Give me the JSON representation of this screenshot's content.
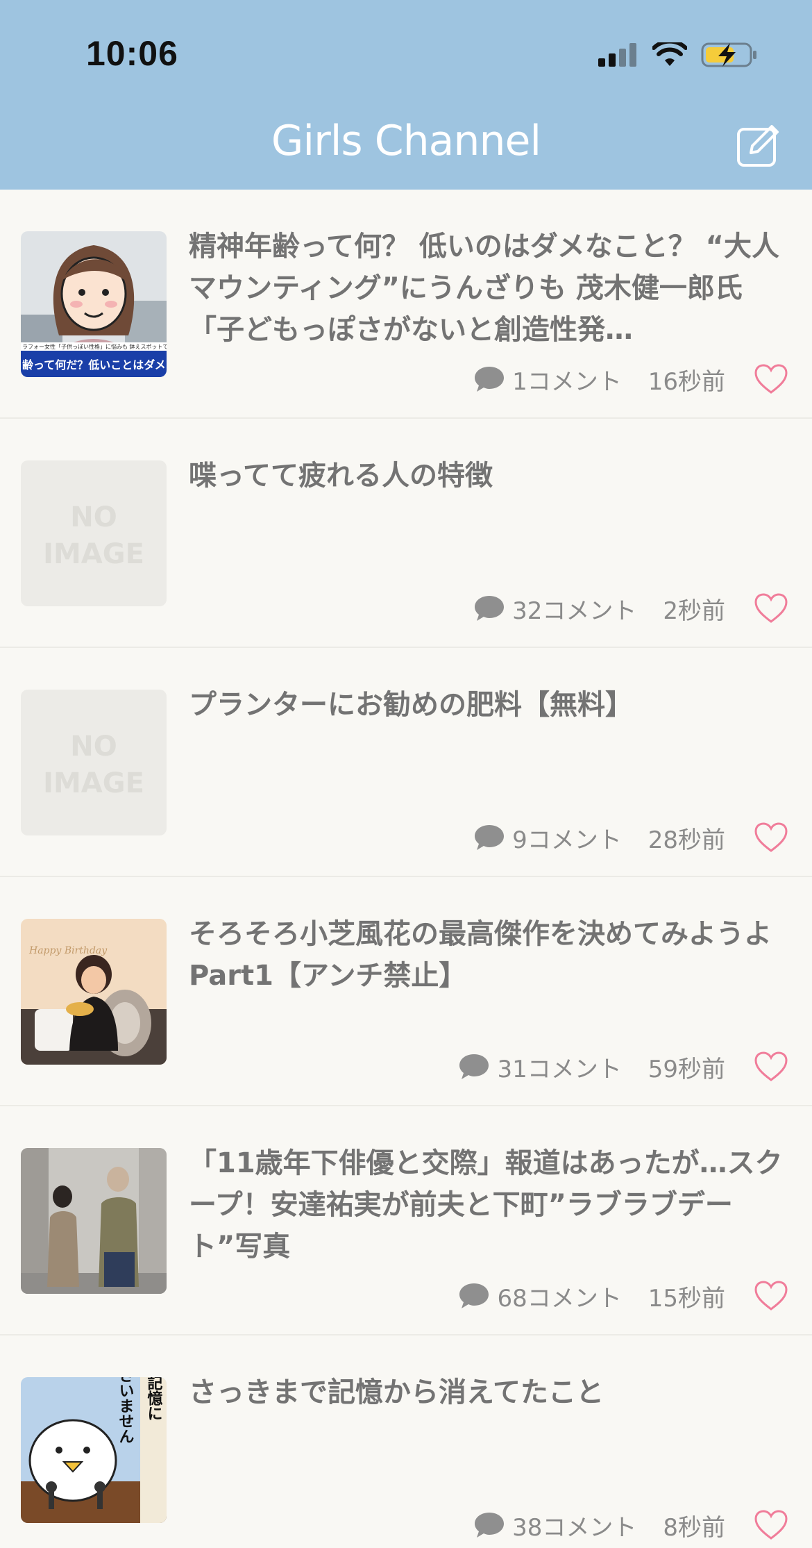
{
  "status_bar": {
    "time": "10:06",
    "icons": [
      "signal-icon",
      "wifi-icon",
      "battery-charging-icon"
    ]
  },
  "header": {
    "title": "Girls Channel",
    "compose_icon": "compose-icon",
    "background_color": "#9ec4e0"
  },
  "topics": [
    {
      "title": "精神年齢って何？ 低いのはダメなこと？ “大人マウンティング”にうんざりも 茂木健一郎氏「子どもっぽさがないと創造性発…",
      "thumbnail": "illustration",
      "thumbnail_caption_top": "ラフォー女性「子供っぽい性格」に悩みも 鉢えスポットではし",
      "thumbnail_caption_bottom": "齢って何だ？低いことはダメなこ",
      "comments": "1コメント",
      "time": "16秒前"
    },
    {
      "title": "喋ってて疲れる人の特徴",
      "thumbnail": "no-image",
      "no_image_text": [
        "NO",
        "IMAGE"
      ],
      "comments": "32コメント",
      "time": "2秒前"
    },
    {
      "title": "プランターにお勧めの肥料【無料】",
      "thumbnail": "no-image",
      "no_image_text": [
        "NO",
        "IMAGE"
      ],
      "comments": "9コメント",
      "time": "28秒前"
    },
    {
      "title": "そろそろ小芝風花の最高傑作を決めてみようよPart1【アンチ禁止】",
      "thumbnail": "photo-birthday",
      "thumbnail_text": "Happy Birthday",
      "comments": "31コメント",
      "time": "59秒前"
    },
    {
      "title": "「11歳年下俳優と交際」報道はあったが…スクープ！安達祐実が前夫と下町”ラブラブデート”写真",
      "thumbnail": "photo-street",
      "comments": "68コメント",
      "time": "15秒前"
    },
    {
      "title": "さっきまで記憶から消えてたこと",
      "thumbnail": "illustration-bird",
      "thumbnail_text": [
        "記憶に",
        "ございません"
      ],
      "comments": "38コメント",
      "time": "8秒前"
    }
  ],
  "colors": {
    "like_heart": "#f07d9a",
    "comment_icon": "#8f8f8f",
    "title_text": "#737373"
  }
}
